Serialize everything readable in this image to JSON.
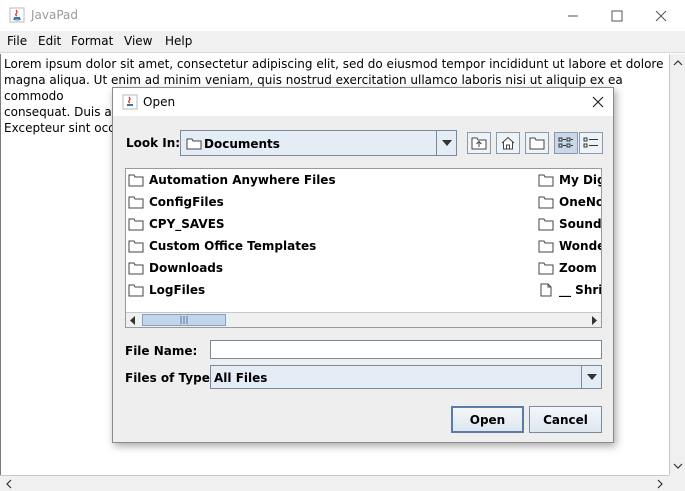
{
  "window": {
    "title": "JavaPad"
  },
  "menu": [
    "File",
    "Edit",
    "Format",
    "View",
    "Help"
  ],
  "editor": {
    "text": "Lorem ipsum dolor sit amet, consectetur adipiscing elit, sed do eiusmod tempor incididunt ut labore et dolore\nmagna aliqua. Ut enim ad minim veniam, quis nostrud exercitation ullamco laboris nisi ut aliquip ex ea commodo\nconsequat. Duis aut\nExcepteur sint occae"
  },
  "dialog": {
    "title": "Open",
    "look_in_label": "Look In:",
    "look_in_value": "Documents",
    "files_left": [
      "Automation Anywhere Files",
      "ConfigFiles",
      "CPY_SAVES",
      "Custom Office Templates",
      "Downloads",
      "LogFiles"
    ],
    "files_right": [
      "My Digit",
      "OneNot",
      "Sound r",
      "Wonder",
      "Zoom",
      "__ Shri"
    ],
    "file_name_label": "File Name:",
    "file_name_value": "",
    "files_of_type_label": "Files of Type:",
    "files_of_type_value": "All Files",
    "open_label": "Open",
    "cancel_label": "Cancel"
  },
  "colors": {
    "accent": "#5a7da8",
    "selected_toggle": "#c9d8e8",
    "combo_bg": "#e4ecf5"
  }
}
